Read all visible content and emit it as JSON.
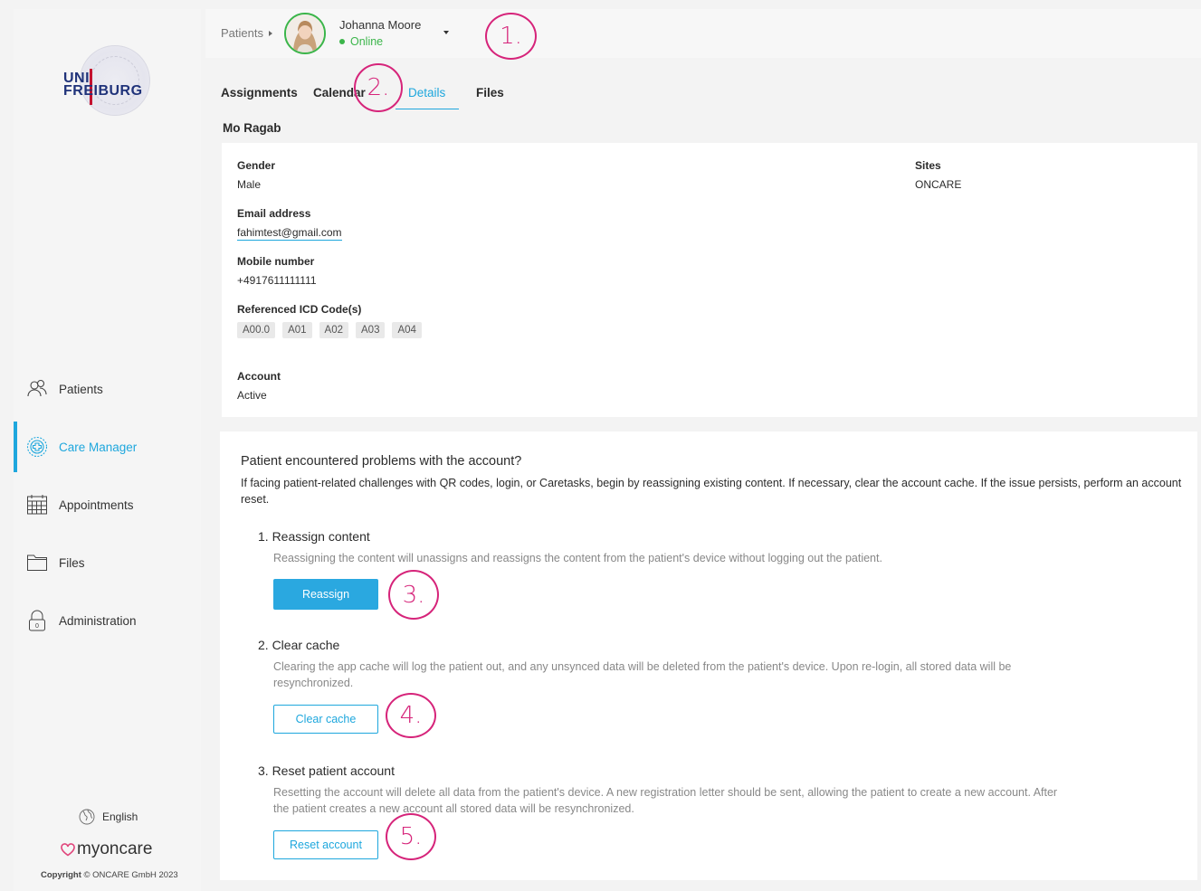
{
  "logo": {
    "line1": "UNI",
    "line2": "FREIBURG"
  },
  "sidebar": {
    "items": [
      {
        "label": "Patients",
        "icon": "patients-icon",
        "active": false
      },
      {
        "label": "Care Manager",
        "icon": "care-manager-icon",
        "active": true
      },
      {
        "label": "Appointments",
        "icon": "calendar-icon",
        "active": false
      },
      {
        "label": "Files",
        "icon": "folder-icon",
        "active": false
      },
      {
        "label": "Administration",
        "icon": "lock-icon",
        "active": false
      }
    ],
    "language": "English",
    "brand": "myoncare",
    "copyright_bold": "Copyright",
    "copyright_rest": " © ONCARE GmbH 2023"
  },
  "header": {
    "breadcrumb": "Patients",
    "user_name": "Johanna Moore",
    "user_status": "Online"
  },
  "tabs": [
    {
      "label": "Assignments",
      "active": false
    },
    {
      "label": "Calendar",
      "active": false
    },
    {
      "label": "Details",
      "active": true
    },
    {
      "label": "Files",
      "active": false
    }
  ],
  "patient": {
    "name": "Mo Ragab",
    "gender_label": "Gender",
    "gender_value": "Male",
    "sites_label": "Sites",
    "sites_value": "ONCARE",
    "email_label": "Email address",
    "email_value": "fahimtest@gmail.com",
    "mobile_label": "Mobile number",
    "mobile_value": "+4917611111111",
    "icd_label": "Referenced ICD Code(s)",
    "icd_codes": [
      "A00.0",
      "A01",
      "A02",
      "A03",
      "A04"
    ],
    "account_label": "Account",
    "account_value": "Active"
  },
  "problems": {
    "title": "Patient encountered problems with the account?",
    "description": "If facing patient-related challenges with QR codes, login, or Caretasks, begin by reassigning existing content. If necessary, clear the account cache. If the issue persists, perform an account reset.",
    "step1_title": "1. Reassign content",
    "step1_desc": "Reassigning the content will unassigns and reassigns the content from the patient's device without logging out the patient.",
    "step1_button": "Reassign",
    "step2_title": "2. Clear cache",
    "step2_desc": "Clearing the app cache will log the patient out, and any unsynced data will be deleted from the patient's device. Upon re-login, all stored data will be resynchronized.",
    "step2_button": "Clear cache",
    "step3_title": "3. Reset patient account",
    "step3_desc": "Resetting the account will delete all data from the patient's device. A new registration letter should be sent, allowing the patient to create a new account. After the patient creates a new account all stored data will be resynchronized.",
    "step3_button": "Reset account"
  },
  "annotations": [
    "1.",
    "2.",
    "3.",
    "4.",
    "5."
  ],
  "colors": {
    "accent": "#1ea7dd",
    "online": "#3bb54a",
    "annotation": "#d6247a",
    "brand_heart": "#e0457b"
  }
}
